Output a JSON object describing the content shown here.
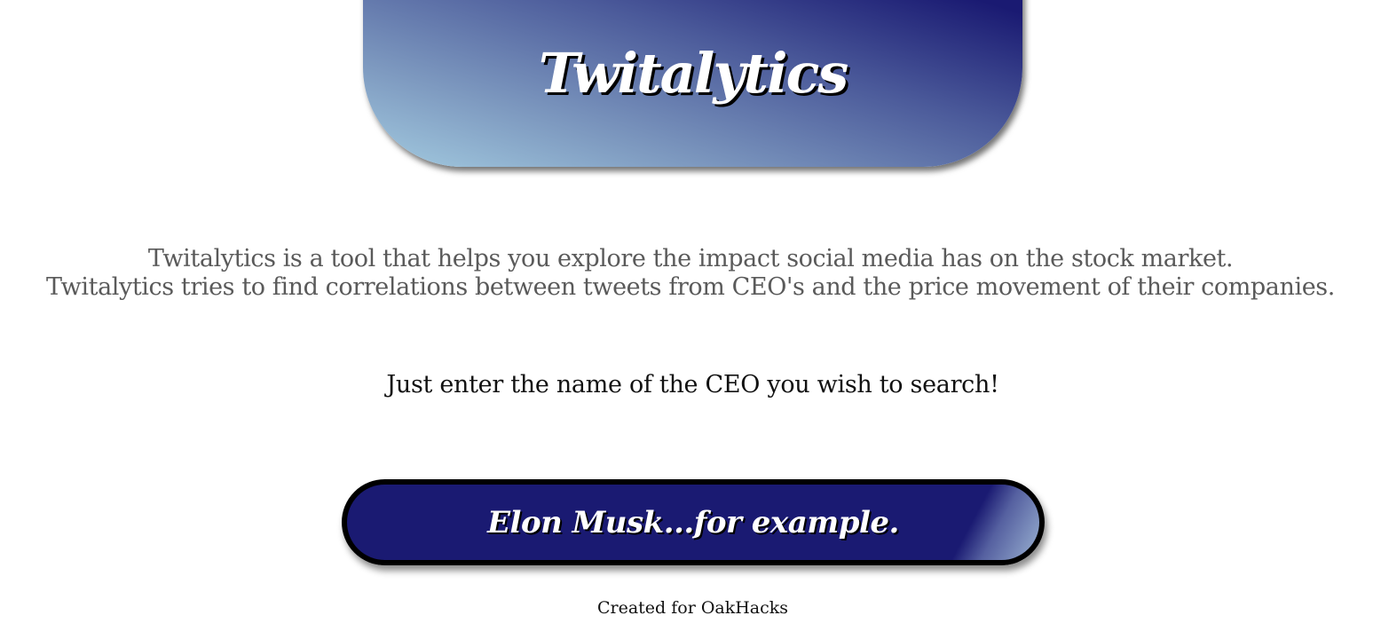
{
  "header": {
    "title": "Twitalytics"
  },
  "description": {
    "line1": "Twitalytics is a tool that helps you explore the impact social media has on the stock market.",
    "line2": "Twitalytics tries to find correlations between tweets from CEO's and the price movement of their companies."
  },
  "prompt": {
    "text": "Just enter the name of the CEO you wish to search!"
  },
  "search": {
    "placeholder": "Elon Musk...for example.",
    "value": ""
  },
  "footer": {
    "credit": "Created for OakHacks"
  },
  "colors": {
    "brand_dark": "#1a1a72",
    "brand_light": "#a3cbe0",
    "text_muted": "#5a5a5a",
    "text_dark": "#111111"
  }
}
